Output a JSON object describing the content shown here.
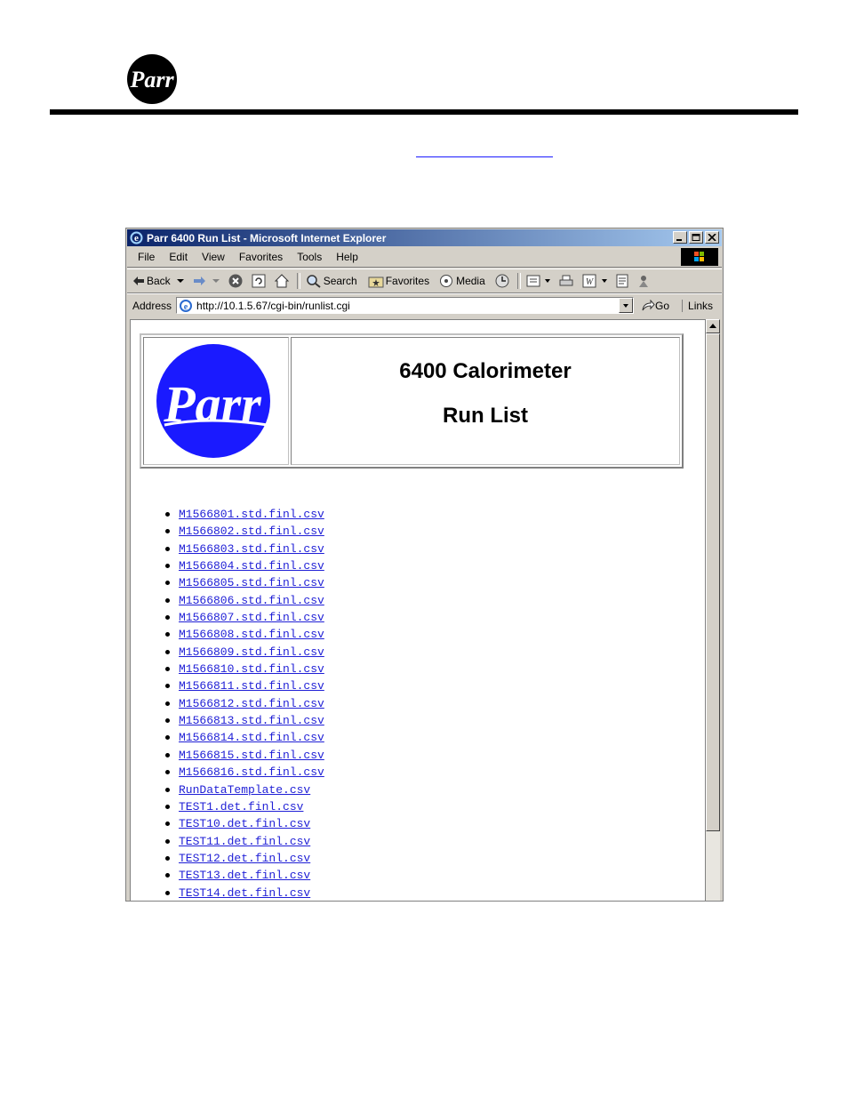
{
  "browser": {
    "title": "Parr 6400 Run List - Microsoft Internet Explorer",
    "menu": [
      "File",
      "Edit",
      "View",
      "Favorites",
      "Tools",
      "Help"
    ],
    "toolbar": {
      "back": "Back",
      "search": "Search",
      "favorites": "Favorites",
      "media": "Media"
    },
    "address": {
      "label": "Address",
      "url": "http://10.1.5.67/cgi-bin/runlist.cgi",
      "go": "Go",
      "links": "Links"
    }
  },
  "page": {
    "title_line1": "6400 Calorimeter",
    "title_line2": "Run List",
    "logo_text": "Parr",
    "logo_color": "#1a1aff",
    "link_color": "#1f1fd6",
    "files": [
      "M1566801.std.finl.csv",
      "M1566802.std.finl.csv",
      "M1566803.std.finl.csv",
      "M1566804.std.finl.csv",
      "M1566805.std.finl.csv",
      "M1566806.std.finl.csv",
      "M1566807.std.finl.csv",
      "M1566808.std.finl.csv",
      "M1566809.std.finl.csv",
      "M1566810.std.finl.csv",
      "M1566811.std.finl.csv",
      "M1566812.std.finl.csv",
      "M1566813.std.finl.csv",
      "M1566814.std.finl.csv",
      "M1566815.std.finl.csv",
      "M1566816.std.finl.csv",
      "RunDataTemplate.csv",
      "TEST1.det.finl.csv",
      "TEST10.det.finl.csv",
      "TEST11.det.finl.csv",
      "TEST12.det.finl.csv",
      "TEST13.det.finl.csv",
      "TEST14.det.finl.csv"
    ]
  },
  "document": {
    "logo_text": "Parr"
  }
}
